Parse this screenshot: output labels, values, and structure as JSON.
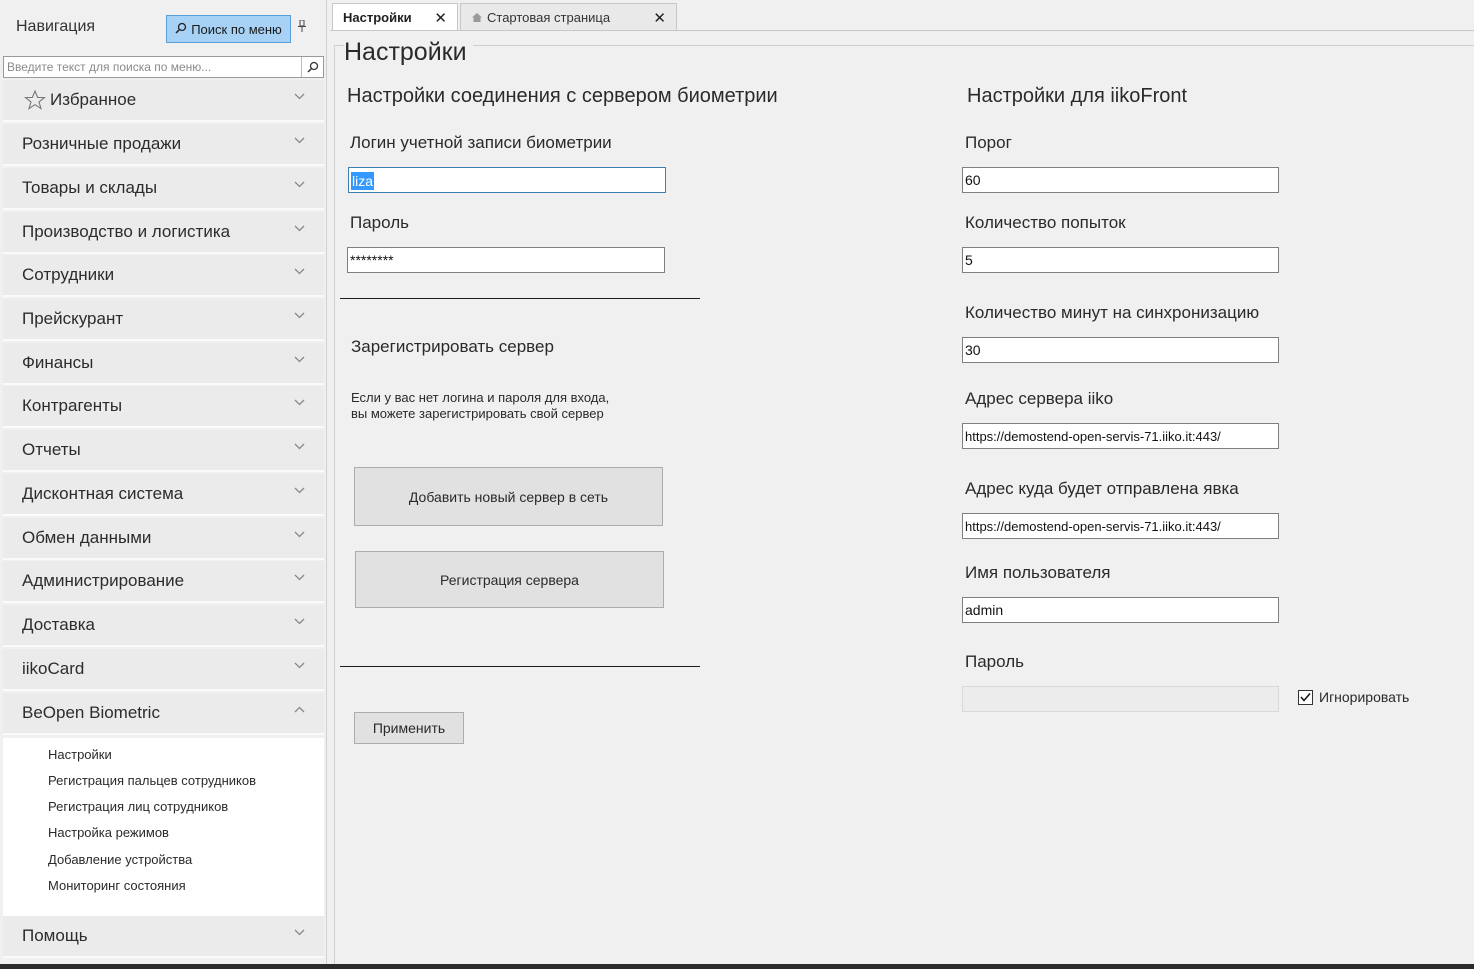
{
  "navigation": {
    "title": "Навигация",
    "search_button_label": "Поиск по меню",
    "search_placeholder": "Введите текст для поиска по меню...",
    "sections": [
      {
        "label": "Избранное",
        "icon": "star-icon",
        "state": "collapsed"
      },
      {
        "label": "Розничные продажи",
        "state": "collapsed"
      },
      {
        "label": "Товары и склады",
        "state": "collapsed"
      },
      {
        "label": "Производство и логистика",
        "state": "collapsed"
      },
      {
        "label": "Сотрудники",
        "state": "collapsed"
      },
      {
        "label": "Прейскурант",
        "state": "collapsed"
      },
      {
        "label": "Финансы",
        "state": "collapsed"
      },
      {
        "label": "Контрагенты",
        "state": "collapsed"
      },
      {
        "label": "Отчеты",
        "state": "collapsed"
      },
      {
        "label": "Дисконтная система",
        "state": "collapsed"
      },
      {
        "label": "Обмен данными",
        "state": "collapsed"
      },
      {
        "label": "Администрирование",
        "state": "collapsed"
      },
      {
        "label": "Доставка",
        "state": "collapsed"
      },
      {
        "label": "iikoCard",
        "state": "collapsed"
      },
      {
        "label": "BeOpen Biometric",
        "state": "expanded"
      }
    ],
    "beopen_items": [
      "Настройки",
      "Регистрация пальцев сотрудников",
      "Регистрация лиц сотрудников",
      "Настройка режимов",
      "Добавление устройства",
      "Мониторинг состояния"
    ],
    "help_label": "Помощь"
  },
  "tabs": [
    {
      "label": "Настройки",
      "active": true
    },
    {
      "label": "Стартовая страница",
      "active": false,
      "icon": "home-icon"
    }
  ],
  "page": {
    "title": "Настройки",
    "left": {
      "header": "Настройки соединения с сервером биометрии",
      "login_label": "Логин учетной записи биометрии",
      "login_value": "liza",
      "password_label": "Пароль",
      "password_value": "********",
      "register_header": "Зарегистрировать сервер",
      "register_note_line1": "Если у вас нет логина и пароля для входа,",
      "register_note_line2": "вы можете зарегистрировать свой сервер",
      "add_server_button": "Добавить новый сервер в сеть",
      "register_server_button": "Регистрация сервера",
      "apply_button": "Применить"
    },
    "right": {
      "header": "Настройки для iikoFront",
      "threshold_label": "Порог",
      "threshold_value": "60",
      "attempts_label": "Количество попыток",
      "attempts_value": "5",
      "sync_minutes_label": "Количество минут на синхронизацию",
      "sync_minutes_value": "30",
      "server_address_label": "Адрес сервера iiko",
      "server_address_value": "https://demostend-open-servis-71.iiko.it:443/",
      "attendance_address_label": "Адрес куда будет отправлена явка",
      "attendance_address_value": "https://demostend-open-servis-71.iiko.it:443/",
      "username_label": "Имя пользователя",
      "username_value": "admin",
      "password_label": "Пароль",
      "password_value": "",
      "ignore_label": "Игнорировать",
      "ignore_checked": true
    }
  },
  "colors": {
    "search_button_bg": "#a8d2f5",
    "selection": "#3399ff",
    "background": "#f0f0f0"
  }
}
